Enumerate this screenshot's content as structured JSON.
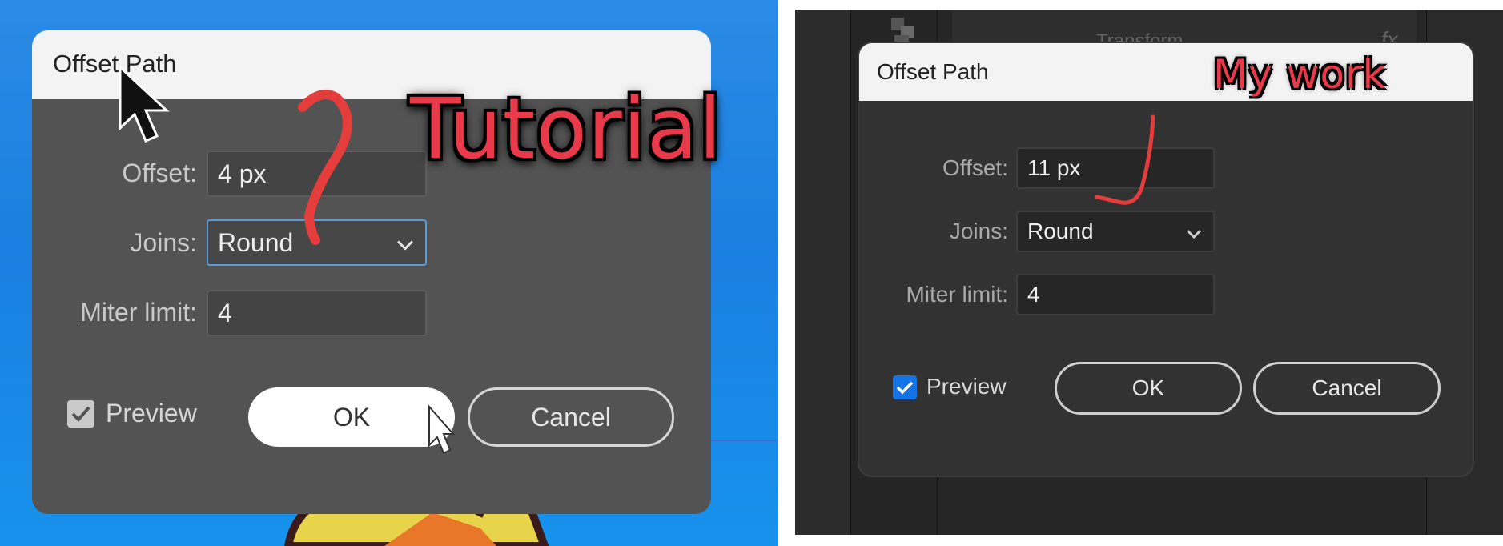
{
  "left": {
    "dialog_title": "Offset Path",
    "annotation": "Tutorial",
    "offset_label": "Offset:",
    "offset_value": "4 px",
    "joins_label": "Joins:",
    "joins_value": "Round",
    "miter_label": "Miter limit:",
    "miter_value": "4",
    "preview_label": "Preview",
    "preview_checked": true,
    "ok_label": "OK",
    "cancel_label": "Cancel"
  },
  "right": {
    "dialog_title": "Offset Path",
    "annotation": "My work",
    "offset_label": "Offset:",
    "offset_value": "11 px",
    "joins_label": "Joins:",
    "joins_value": "Round",
    "miter_label": "Miter limit:",
    "miter_value": "4",
    "preview_label": "Preview",
    "preview_checked": true,
    "ok_label": "OK",
    "cancel_label": "Cancel",
    "background_panel_label": "Transform",
    "background_fx_label": "fx"
  },
  "colors": {
    "annotation_red": "#e83a4a",
    "checkbox_blue": "#1473e6",
    "dialog_dark": "#323232",
    "dialog_medium": "#535353",
    "titlebar": "#f3f3f3"
  },
  "icons": [
    "chevron-down-icon",
    "checkmark-icon",
    "mouse-pointer-icon",
    "app-tool-icon"
  ]
}
